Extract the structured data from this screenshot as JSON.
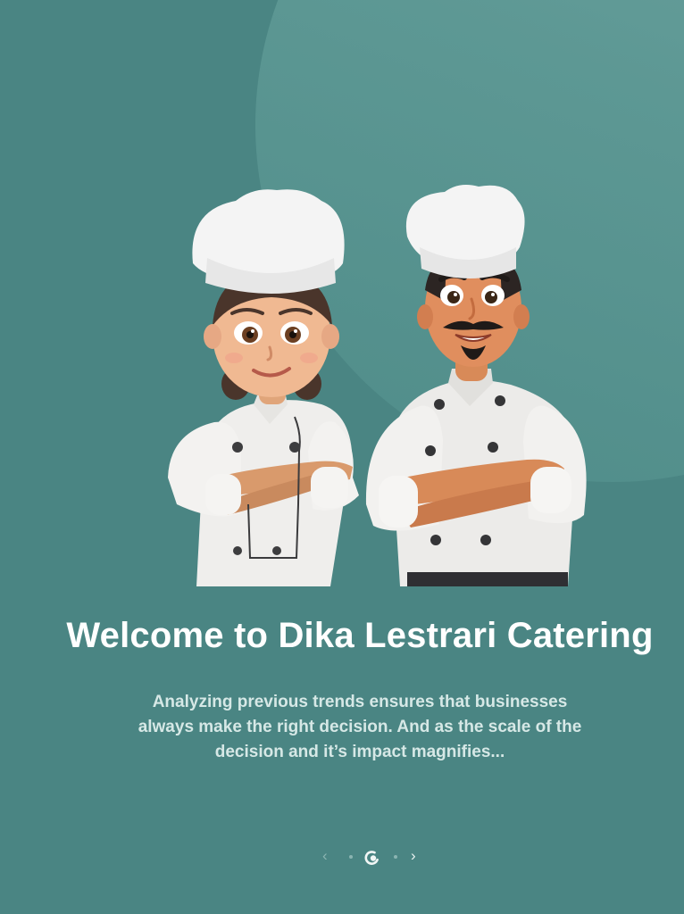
{
  "onboarding": {
    "title": "Welcome to Dika Lestrari Catering",
    "description": "Analyzing previous trends ensures that businesses always make the right decision. And as the scale of the decision and it’s impact magnifies...",
    "illustration": "two-chefs-with-crossed-arms",
    "background_color": "#4a8583",
    "accent_circle_color": "#6fa3a0",
    "pager": {
      "prev_icon": "chevron-left-icon",
      "prev_symbol": "‹",
      "next_icon": "chevron-right-icon",
      "next_symbol": "›",
      "page_count": 3,
      "current_page": 2
    }
  }
}
